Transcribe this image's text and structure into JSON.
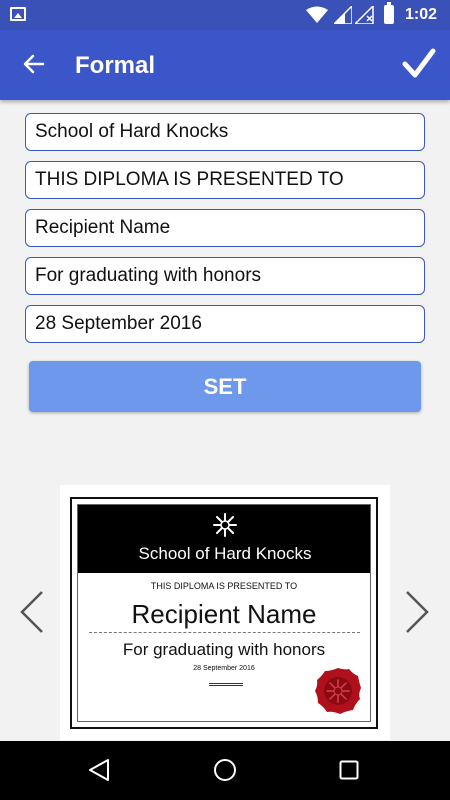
{
  "status_bar": {
    "time": "1:02",
    "icons": [
      "image-notification-icon",
      "wifi-icon",
      "signal-icon",
      "no-sim-icon",
      "battery-icon"
    ]
  },
  "app_bar": {
    "title": "Formal",
    "back_icon": "arrow-left-icon",
    "confirm_icon": "checkmark-icon"
  },
  "form": {
    "school": "School of Hard Knocks",
    "presented": "THIS DIPLOMA IS PRESENTED TO",
    "recipient": "Recipient Name",
    "achievement": "For graduating with honors",
    "date": "28 September 2016",
    "set_label": "SET"
  },
  "preview": {
    "school": "School of Hard Knocks",
    "presented": "THIS DIPLOMA IS PRESENTED TO",
    "recipient": "Recipient Name",
    "achievement": "For graduating with honors",
    "date": "28 September 2016",
    "header_bg": "#000000",
    "seal_color": "#b0101c"
  },
  "navigation": {
    "prev_icon": "chevron-left-icon",
    "next_icon": "chevron-right-icon"
  },
  "system_nav": [
    "back-triangle-icon",
    "home-circle-icon",
    "recents-square-icon"
  ],
  "colors": {
    "accent": "#3a56c9",
    "status_bar": "#3a51b8",
    "set_button": "#6d98ec",
    "cursor": "#d81b60"
  }
}
